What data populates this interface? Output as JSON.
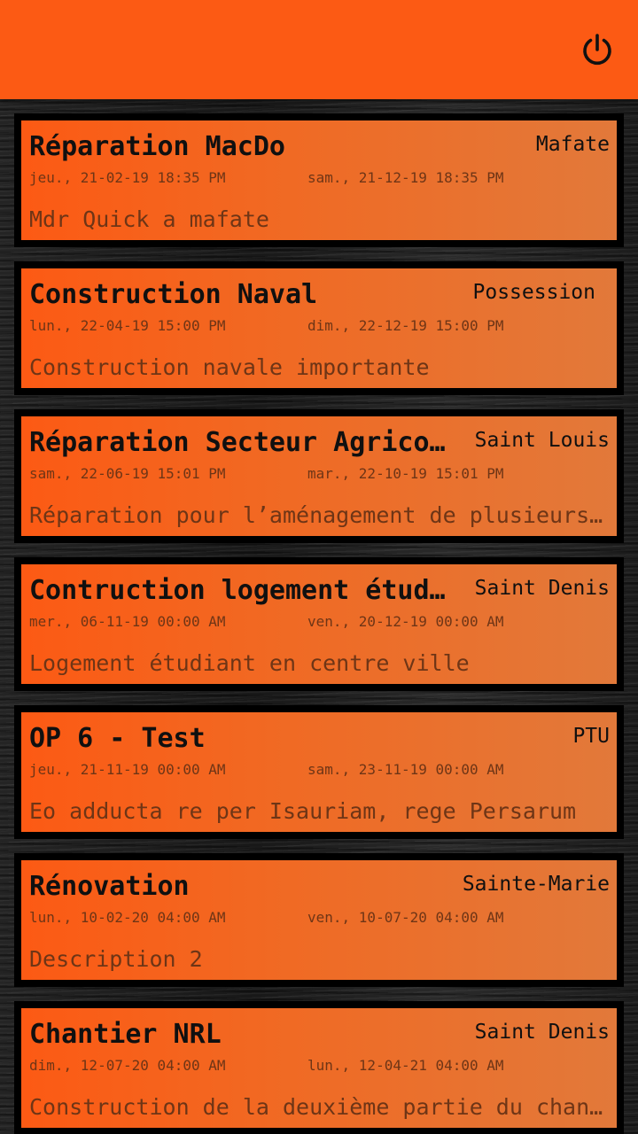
{
  "header": {
    "power_icon": "power-icon",
    "color": "#fc5a14"
  },
  "colors": {
    "card_start": "#fc5a14",
    "card_end": "#e2793a",
    "border": "#000000"
  },
  "cards": [
    {
      "title": "Réparation MacDo",
      "location": "Mafate",
      "start": "jeu., 21-02-19  18:35 PM",
      "end": "sam., 21-12-19  18:35 PM",
      "description": "Mdr Quick a mafate"
    },
    {
      "title": "Construction Naval",
      "location": "Possession",
      "start": "lun., 22-04-19  15:00 PM",
      "end": "dim., 22-12-19  15:00 PM",
      "description": "Construction navale importante"
    },
    {
      "title": "Réparation Secteur Agricole",
      "location": "Saint Louis",
      "start": "sam., 22-06-19  15:01 PM",
      "end": "mar., 22-10-19  15:01 PM",
      "description": "Réparation pour l’aménagement de plusieurs secteurs"
    },
    {
      "title": "Contruction logement étudiant",
      "location": "Saint Denis",
      "start": "mer., 06-11-19  00:00 AM",
      "end": "ven., 20-12-19  00:00 AM",
      "description": "Logement étudiant en centre ville"
    },
    {
      "title": "OP 6 - Test",
      "location": "PTU",
      "start": "jeu., 21-11-19  00:00 AM",
      "end": "sam., 23-11-19  00:00 AM",
      "description": "Eo adducta re per Isauriam, rege Persarum"
    },
    {
      "title": "Rénovation",
      "location": "Sainte-Marie",
      "start": "lun., 10-02-20  04:00 AM",
      "end": "ven., 10-07-20  04:00 AM",
      "description": "Description 2"
    },
    {
      "title": "Chantier NRL",
      "location": "Saint Denis",
      "start": "dim., 12-07-20  04:00 AM",
      "end": "lun., 12-04-21  04:00 AM",
      "description": "Construction de la deuxième partie du chantier"
    }
  ]
}
